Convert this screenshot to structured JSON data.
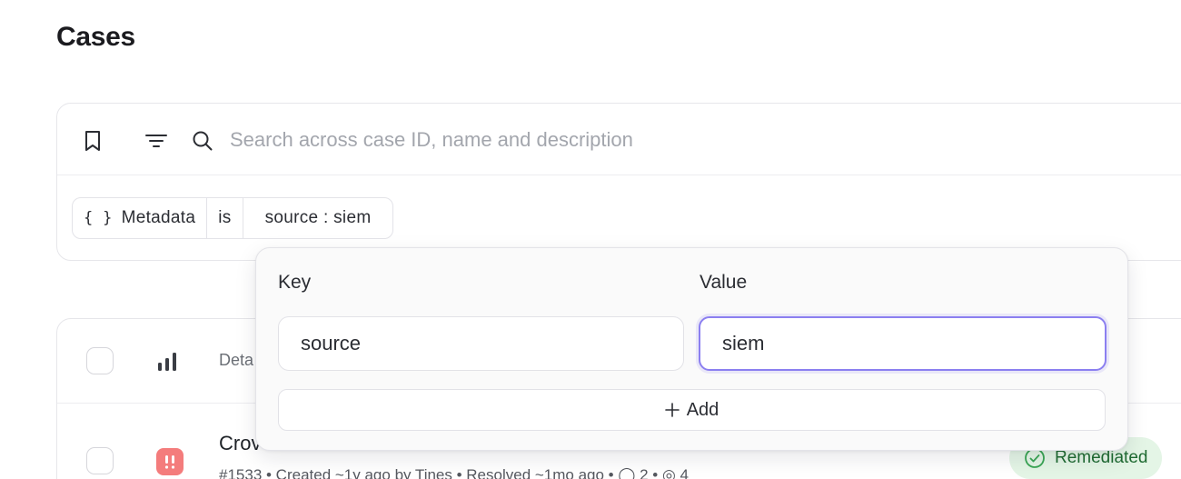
{
  "page": {
    "title": "Cases"
  },
  "toolbar": {
    "bookmark_icon": "bookmark-icon",
    "filter_icon": "filter-icon",
    "search_icon": "search-icon",
    "search_placeholder": "Search across case ID, name and description",
    "search_value": ""
  },
  "filter_chip": {
    "icon_text": "{ }",
    "field": "Metadata",
    "operator": "is",
    "value": "source : siem"
  },
  "table": {
    "header": {
      "column_label": "Deta"
    },
    "rows": [
      {
        "priority_icon": "alert-icon",
        "title": "Crov",
        "meta": "#1533  •  Created ~1y ago by Tines  •  Resolved ~1mo ago  •  ◯ 2  •  ◎ 4",
        "status": "Remediated",
        "status_color": "#1f6b32"
      }
    ]
  },
  "popover": {
    "key_label": "Key",
    "value_label": "Value",
    "key_value": "source",
    "value_value": "siem",
    "add_label": "Add",
    "accent_color": "#8b7ff0"
  }
}
